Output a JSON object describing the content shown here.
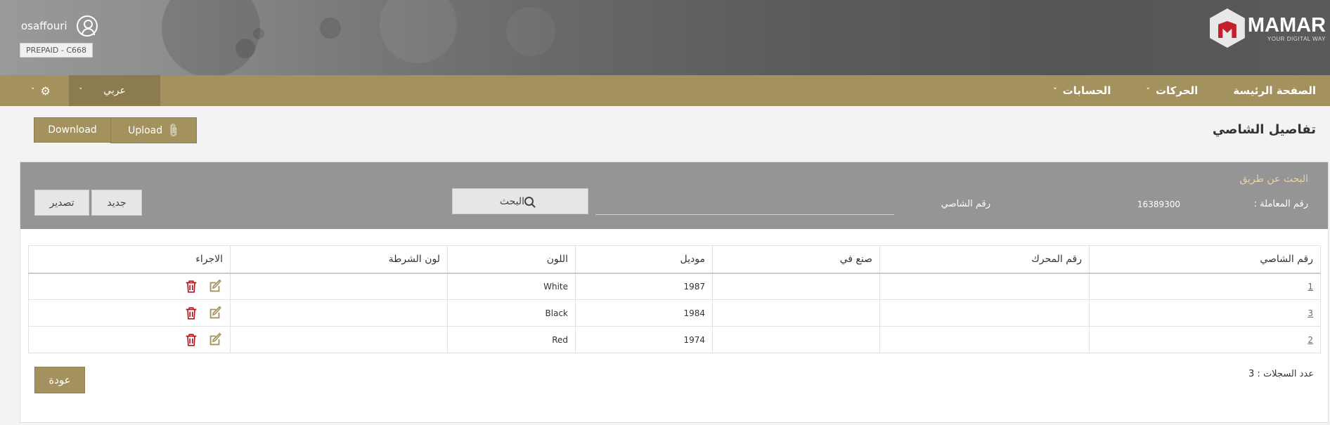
{
  "header": {
    "username": "osaffouri",
    "account_badge": "PREPAID - C668",
    "logo_name": "MAMAR",
    "logo_tagline": "YOUR DIGITAL WAY"
  },
  "nav": {
    "items": [
      {
        "label": "الصفحة الرئيسة",
        "has_dropdown": false
      },
      {
        "label": "الحركات",
        "has_dropdown": true
      },
      {
        "label": "الحسابات",
        "has_dropdown": true
      }
    ],
    "language": "عربي",
    "settings_icon": "gear-icon",
    "chevron": "˅"
  },
  "page": {
    "title": "تفاصيل الشاصي",
    "download_label": "Download",
    "upload_label": "Upload"
  },
  "search": {
    "heading": "البحث عن طريق",
    "transaction_label": "رقم المعاملة :",
    "transaction_value": "16389300",
    "chassis_label": "رقم الشاصي",
    "chassis_value": "",
    "search_button": "البحث",
    "new_button": "جديد",
    "export_button": "تصدير"
  },
  "table": {
    "headers": [
      "رقم الشاصي",
      "رقم المحرك",
      "صنع في",
      "موديل",
      "اللون",
      "لون الشرطة",
      "الاجراء"
    ],
    "rows": [
      {
        "chassis": "1",
        "engine": "",
        "made_in": "",
        "model": "1987",
        "color": "White",
        "stripe": ""
      },
      {
        "chassis": "3",
        "engine": "",
        "made_in": "",
        "model": "1984",
        "color": "Black",
        "stripe": ""
      },
      {
        "chassis": "2",
        "engine": "",
        "made_in": "",
        "model": "1974",
        "color": "Red",
        "stripe": ""
      }
    ]
  },
  "footer": {
    "records_count": "عدد السجلات : 3",
    "back_button": "عودة"
  },
  "colors": {
    "gold": "#a3915e",
    "gold_dark": "#8c7b4f",
    "search_panel": "#959596",
    "delete_red": "#b3141e",
    "edit_gold": "#a3915e",
    "search_heading": "#e9d3a3"
  }
}
